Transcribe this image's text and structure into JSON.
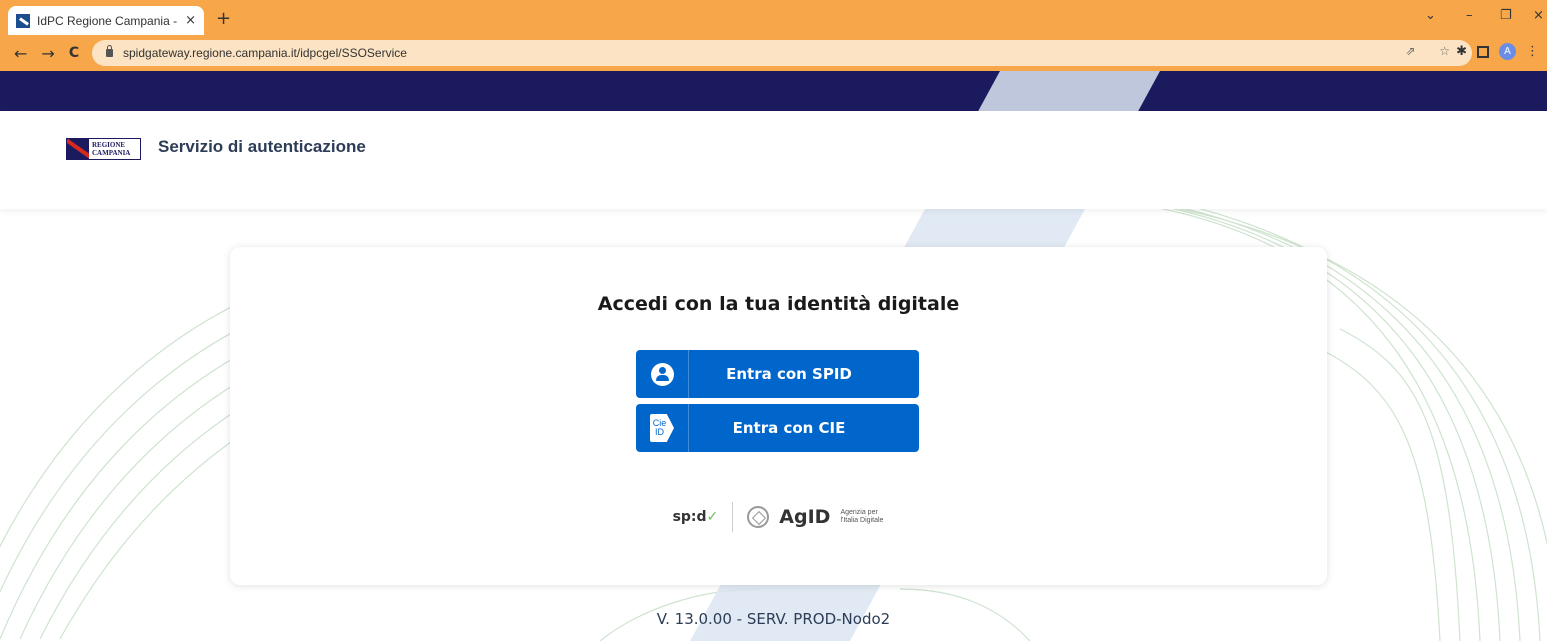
{
  "browser": {
    "tab_title": "IdPC Regione Campania - Selezio",
    "tab_close": "×",
    "new_tab": "+",
    "url": "spidgateway.regione.campania.it/idpcgel/SSOService",
    "back": "←",
    "forward": "→",
    "reload": "C",
    "window_controls": {
      "dropdown": "⌄",
      "minimize": "–",
      "restore": "❐",
      "close": "×"
    },
    "omnibox_icons": "⇗ ☆",
    "extensions": {
      "puzzle": "✱",
      "profile_initial": "A",
      "menu": "⋮"
    }
  },
  "header": {
    "logo_text": "REGIONE\nCAMPANIA",
    "title": "Servizio di autenticazione"
  },
  "card": {
    "title": "Accedi con la tua identità digitale",
    "spid_button": "Entra con SPID",
    "cie_button": "Entra con CIE",
    "cie_icon_text": "Cie ID",
    "spid_logo": "sp:d",
    "agid_logo": "AgID",
    "agid_sub": "Agenzia per l'Italia Digitale"
  },
  "footer": {
    "version": "V. 13.0.00 - SERV. PROD-Nodo2"
  },
  "colors": {
    "browser_chrome": "#f7a64a",
    "top_band": "#1c1a5e",
    "primary_button": "#0066cc",
    "background_slash": "#dce6f2",
    "wave_lines": "#cfe3cf"
  }
}
